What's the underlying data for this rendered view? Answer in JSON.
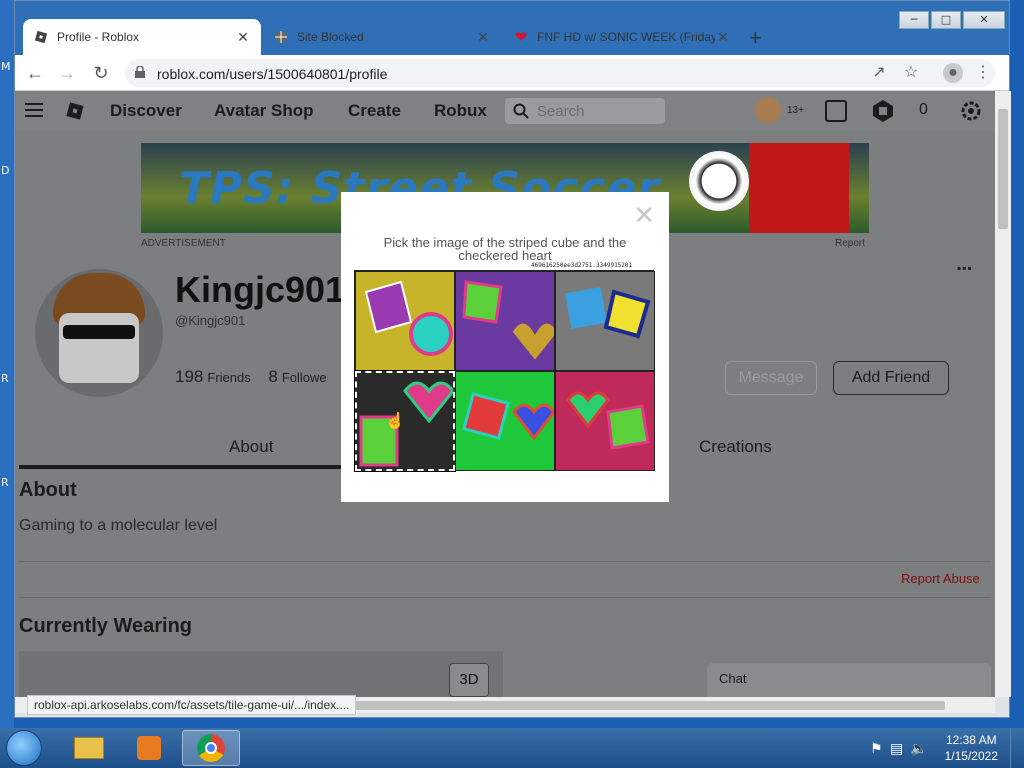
{
  "desktop": {
    "edge_letters": [
      "M",
      "D",
      "R",
      "R"
    ]
  },
  "window": {
    "controls": [
      "minimize",
      "maximize",
      "close"
    ]
  },
  "tabs": [
    {
      "title": "Profile - Roblox",
      "icon": "roblox-icon",
      "active": true
    },
    {
      "title": "Site Blocked",
      "icon": "globe-icon",
      "active": false
    },
    {
      "title": "FNF HD w/ SONIC WEEK (Friday",
      "icon": "heart-icon",
      "active": false
    }
  ],
  "toolbar": {
    "url": "roblox.com/users/1500640801/profile"
  },
  "roblox_nav": {
    "links": [
      "Discover",
      "Avatar Shop",
      "Create",
      "Robux"
    ],
    "search_placeholder": "Search",
    "age_badge": "13+",
    "robux_count": "0"
  },
  "ad": {
    "title": "TPS: Street Soccer",
    "label": "ADVERTISEMENT",
    "report": "Report"
  },
  "profile": {
    "display_name": "Kingjc901",
    "username": "@Kingjc901",
    "friends_count": "198",
    "friends_label": "Friends",
    "followers_count": "8",
    "followers_label": "Followe",
    "message_button": "Message",
    "add_friend_button": "Add Friend",
    "more_dots": "▪▪▪"
  },
  "profile_tabs": [
    "About",
    "Creations"
  ],
  "about": {
    "heading": "About",
    "text": "Gaming to a molecular level",
    "report_abuse": "Report Abuse"
  },
  "wearing": {
    "heading": "Currently Wearing",
    "button_3d": "3D"
  },
  "chat": {
    "label": "Chat"
  },
  "captcha": {
    "prompt": "Pick the image of the striped cube and the checkered heart",
    "ticket": "469616250ee3d2751.3349915201",
    "selected_tile_index": 3,
    "tiles": [
      {
        "bg": "#c8b42a"
      },
      {
        "bg": "#6a3aa0"
      },
      {
        "bg": "#7a7a7a"
      },
      {
        "bg": "#2a2a2a"
      },
      {
        "bg": "#1ec83a"
      },
      {
        "bg": "#c02a5a"
      }
    ]
  },
  "status_bar": {
    "url": "roblox-api.arkoselabs.com/fc/assets/tile-game-ui/.../index...."
  },
  "taskbar": {
    "items": [
      "explorer",
      "media-player",
      "chrome"
    ],
    "time": "12:38 AM",
    "date": "1/15/2022"
  }
}
